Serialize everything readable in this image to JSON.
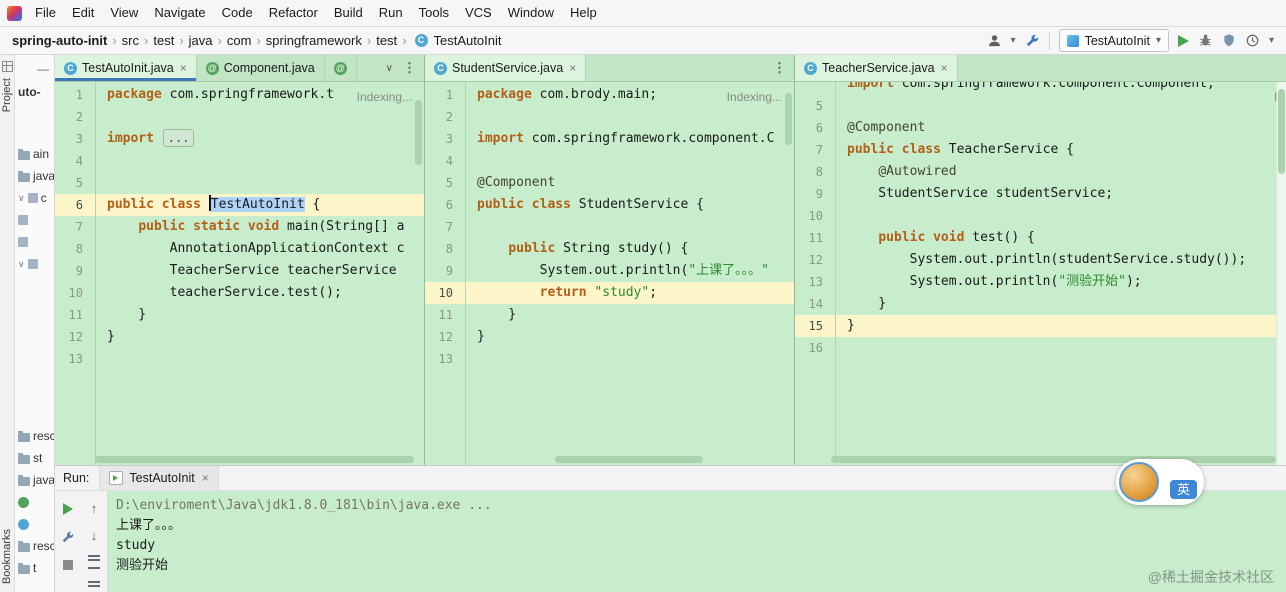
{
  "menu_bar": {
    "items": [
      "File",
      "Edit",
      "View",
      "Navigate",
      "Code",
      "Refactor",
      "Build",
      "Run",
      "Tools",
      "VCS",
      "Window",
      "Help"
    ]
  },
  "toolbar": {
    "breadcrumbs": [
      "spring-auto-init",
      "src",
      "test",
      "java",
      "com",
      "springframework",
      "test"
    ],
    "file": "TestAutoInit",
    "run_config": "TestAutoInit"
  },
  "icons": {
    "chevron_down": "▾",
    "collapse": "∨",
    "dots": "⋮",
    "close": "×",
    "crumb_sep": "›",
    "hide": "—",
    "up_arrow": "↑",
    "down_arrow": "↓"
  },
  "strips": {
    "top": "Project",
    "bottom": "Bookmarks"
  },
  "project_tree": {
    "items": [
      {
        "label": "uto-",
        "bold": true
      },
      {
        "spacer": 40
      },
      {
        "label": "ain",
        "icon": "folder"
      },
      {
        "label": "java",
        "icon": "folder"
      },
      {
        "label": "c",
        "icon": "pkg",
        "chev": true
      },
      {
        "label": "",
        "icon": "pkg"
      },
      {
        "label": "",
        "icon": "pkg"
      },
      {
        "label": "",
        "icon": "pkg",
        "chev": true
      },
      {
        "spacer": 150
      },
      {
        "label": "resc",
        "icon": "folder"
      },
      {
        "label": "st",
        "icon": "folder"
      },
      {
        "label": "java",
        "icon": "folder"
      },
      {
        "label": "",
        "icon": "comp"
      },
      {
        "label": "",
        "icon": "class"
      },
      {
        "label": "resc",
        "icon": "folder"
      },
      {
        "label": "t",
        "icon": "folder"
      }
    ]
  },
  "panes": [
    {
      "tabs": [
        {
          "label": "TestAutoInit.java",
          "icon": "class",
          "close": true,
          "active": true,
          "focused": true
        },
        {
          "label": "Component.java",
          "icon": "comp",
          "close": false
        },
        {
          "label": "",
          "icon": "comp",
          "close": false
        }
      ],
      "show_chevron": true,
      "show_dots": true,
      "indexing": "Indexing...",
      "lines": [
        {
          "n": "1",
          "tokens": [
            [
              "kw",
              "package"
            ],
            [
              "txt",
              " com.springframework.t"
            ]
          ]
        },
        {
          "n": "2",
          "tokens": []
        },
        {
          "n": "3",
          "tokens": [
            [
              "kw",
              "import"
            ],
            [
              "txt",
              " "
            ],
            [
              "fold",
              "..."
            ]
          ]
        },
        {
          "n": "4",
          "tokens": []
        },
        {
          "n": "5",
          "tokens": []
        },
        {
          "n": "6",
          "hl": true,
          "tokens": [
            [
              "kw",
              "public"
            ],
            [
              "txt",
              " "
            ],
            [
              "kw",
              "class"
            ],
            [
              "txt",
              " "
            ],
            [
              "caret",
              ""
            ],
            [
              "sel",
              "TestAutoInit"
            ],
            [
              "txt",
              " {"
            ]
          ]
        },
        {
          "n": "7",
          "tokens": [
            [
              "txt",
              "    "
            ],
            [
              "kw",
              "public"
            ],
            [
              "txt",
              " "
            ],
            [
              "kw",
              "static"
            ],
            [
              "txt",
              " "
            ],
            [
              "kw",
              "void"
            ],
            [
              "txt",
              " main(String[] a"
            ]
          ]
        },
        {
          "n": "8",
          "tokens": [
            [
              "txt",
              "        AnnotationApplicationContext c"
            ]
          ]
        },
        {
          "n": "9",
          "tokens": [
            [
              "txt",
              "        TeacherService teacherService"
            ]
          ]
        },
        {
          "n": "10",
          "tokens": [
            [
              "txt",
              "        teacherService.test();"
            ]
          ]
        },
        {
          "n": "11",
          "tokens": [
            [
              "txt",
              "    }"
            ]
          ]
        },
        {
          "n": "12",
          "tokens": [
            [
              "txt",
              "}"
            ]
          ]
        },
        {
          "n": "13",
          "tokens": []
        }
      ]
    },
    {
      "tabs": [
        {
          "label": "StudentService.java",
          "icon": "class",
          "close": true,
          "active": true
        }
      ],
      "show_dots": true,
      "indexing": "Indexing...",
      "lines": [
        {
          "n": "1",
          "tokens": [
            [
              "kw",
              "package"
            ],
            [
              "txt",
              " com.brody.main;"
            ]
          ]
        },
        {
          "n": "2",
          "tokens": []
        },
        {
          "n": "3",
          "tokens": [
            [
              "kw",
              "import"
            ],
            [
              "txt",
              " com.springframework.component.C"
            ]
          ]
        },
        {
          "n": "4",
          "tokens": []
        },
        {
          "n": "5",
          "tokens": [
            [
              "ann",
              "@Component"
            ]
          ]
        },
        {
          "n": "6",
          "tokens": [
            [
              "kw",
              "public"
            ],
            [
              "txt",
              " "
            ],
            [
              "kw",
              "class"
            ],
            [
              "txt",
              " StudentService {"
            ]
          ]
        },
        {
          "n": "7",
          "tokens": []
        },
        {
          "n": "8",
          "tokens": [
            [
              "txt",
              "    "
            ],
            [
              "kw",
              "public"
            ],
            [
              "txt",
              " String study() {"
            ]
          ]
        },
        {
          "n": "9",
          "tokens": [
            [
              "txt",
              "        System.out.println("
            ],
            [
              "str",
              "\"上课了。。。\""
            ]
          ]
        },
        {
          "n": "10",
          "hl": true,
          "tokens": [
            [
              "txt",
              "        "
            ],
            [
              "kw",
              "return"
            ],
            [
              "txt",
              " "
            ],
            [
              "str",
              "\"study\""
            ],
            [
              "txt",
              ";"
            ]
          ]
        },
        {
          "n": "11",
          "tokens": [
            [
              "txt",
              "    }"
            ]
          ]
        },
        {
          "n": "12",
          "tokens": [
            [
              "txt",
              "}"
            ]
          ]
        },
        {
          "n": "13",
          "tokens": []
        }
      ]
    },
    {
      "tabs": [
        {
          "label": "TeacherService.java",
          "icon": "class",
          "close": true,
          "active": true
        }
      ],
      "indexing": "In",
      "lines": [
        {
          "n": "",
          "clip": true,
          "tokens": [
            [
              "kw",
              "import"
            ],
            [
              "txt",
              " com.springframework.component.Component;"
            ]
          ]
        },
        {
          "n": "5",
          "tokens": []
        },
        {
          "n": "6",
          "tokens": [
            [
              "ann",
              "@Component"
            ]
          ]
        },
        {
          "n": "7",
          "tokens": [
            [
              "kw",
              "public"
            ],
            [
              "txt",
              " "
            ],
            [
              "kw",
              "class"
            ],
            [
              "txt",
              " TeacherService {"
            ]
          ]
        },
        {
          "n": "8",
          "tokens": [
            [
              "txt",
              "    "
            ],
            [
              "ann",
              "@Autowired"
            ]
          ]
        },
        {
          "n": "9",
          "tokens": [
            [
              "txt",
              "    StudentService studentService;"
            ]
          ]
        },
        {
          "n": "10",
          "tokens": []
        },
        {
          "n": "11",
          "tokens": [
            [
              "txt",
              "    "
            ],
            [
              "kw",
              "public"
            ],
            [
              "txt",
              " "
            ],
            [
              "kw",
              "void"
            ],
            [
              "txt",
              " test() {"
            ]
          ]
        },
        {
          "n": "12",
          "tokens": [
            [
              "txt",
              "        System.out.println(studentService.study());"
            ]
          ]
        },
        {
          "n": "13",
          "tokens": [
            [
              "txt",
              "        System.out.println("
            ],
            [
              "str",
              "\"测验开始\""
            ],
            [
              "txt",
              ");"
            ]
          ]
        },
        {
          "n": "14",
          "tokens": [
            [
              "txt",
              "    }"
            ]
          ]
        },
        {
          "n": "15",
          "hl": true,
          "tokens": [
            [
              "txt",
              "}"
            ]
          ]
        },
        {
          "n": "16",
          "tokens": []
        }
      ]
    }
  ],
  "run_panel": {
    "label": "Run:",
    "tab": "TestAutoInit",
    "console": [
      {
        "style": "cmd",
        "text": "D:\\enviroment\\Java\\jdk1.8.0_181\\bin\\java.exe ..."
      },
      {
        "style": "out",
        "text": "上课了。。。"
      },
      {
        "style": "out",
        "text": "study"
      },
      {
        "style": "out",
        "text": "测验开始"
      }
    ]
  },
  "ime": {
    "badge": "英"
  },
  "watermark": "@稀土掘金技术社区",
  "colors": {
    "editor_bg": "#C7EDCC",
    "keyword": "#B45F17",
    "string": "#2D8C2D",
    "highlight_line": "#FBF5C9",
    "accent": "#3E77BB"
  }
}
